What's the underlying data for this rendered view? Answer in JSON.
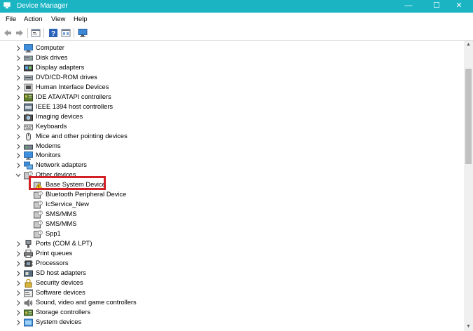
{
  "window": {
    "title": "Device Manager",
    "controls": {
      "minimize": "—",
      "maximize": "☐",
      "close": "✕"
    }
  },
  "menu": [
    "File",
    "Action",
    "View",
    "Help"
  ],
  "toolbar": [
    {
      "icon": "back-arrow-icon"
    },
    {
      "icon": "forward-arrow-icon"
    },
    {
      "icon": "properties-icon"
    },
    {
      "icon": "help-icon"
    },
    {
      "icon": "show-hidden-icon"
    },
    {
      "icon": "monitor-scan-icon"
    }
  ],
  "tree": {
    "categories": [
      {
        "label": "Computer",
        "icon": "computer-icon",
        "expanded": false
      },
      {
        "label": "Disk drives",
        "icon": "disk-drive-icon",
        "expanded": false
      },
      {
        "label": "Display adapters",
        "icon": "display-adapter-icon",
        "expanded": false
      },
      {
        "label": "DVD/CD-ROM drives",
        "icon": "dvd-drive-icon",
        "expanded": false
      },
      {
        "label": "Human Interface Devices",
        "icon": "hid-icon",
        "expanded": false
      },
      {
        "label": "IDE ATA/ATAPI controllers",
        "icon": "ide-controller-icon",
        "expanded": false
      },
      {
        "label": "IEEE 1394 host controllers",
        "icon": "ieee1394-icon",
        "expanded": false
      },
      {
        "label": "Imaging devices",
        "icon": "camera-icon",
        "expanded": false
      },
      {
        "label": "Keyboards",
        "icon": "keyboard-icon",
        "expanded": false
      },
      {
        "label": "Mice and other pointing devices",
        "icon": "mouse-icon",
        "expanded": false
      },
      {
        "label": "Modems",
        "icon": "modem-icon",
        "expanded": false
      },
      {
        "label": "Monitors",
        "icon": "monitor-icon",
        "expanded": false
      },
      {
        "label": "Network adapters",
        "icon": "network-adapter-icon",
        "expanded": false
      },
      {
        "label": "Other devices",
        "icon": "unknown-device-icon",
        "expanded": true,
        "children": [
          {
            "label": "Base System Device",
            "icon": "warning-device-icon",
            "highlighted": true
          },
          {
            "label": "Bluetooth Peripheral Device",
            "icon": "unknown-device-icon"
          },
          {
            "label": "IcService_New",
            "icon": "unknown-device-icon"
          },
          {
            "label": "SMS/MMS",
            "icon": "unknown-device-icon"
          },
          {
            "label": "SMS/MMS",
            "icon": "unknown-device-icon"
          },
          {
            "label": "Spp1",
            "icon": "unknown-device-icon"
          }
        ]
      },
      {
        "label": "Ports (COM & LPT)",
        "icon": "port-icon",
        "expanded": false
      },
      {
        "label": "Print queues",
        "icon": "printer-icon",
        "expanded": false
      },
      {
        "label": "Processors",
        "icon": "processor-icon",
        "expanded": false
      },
      {
        "label": "SD host adapters",
        "icon": "sd-adapter-icon",
        "expanded": false
      },
      {
        "label": "Security devices",
        "icon": "security-device-icon",
        "expanded": false
      },
      {
        "label": "Software devices",
        "icon": "software-device-icon",
        "expanded": false
      },
      {
        "label": "Sound, video and game controllers",
        "icon": "sound-icon",
        "expanded": false
      },
      {
        "label": "Storage controllers",
        "icon": "storage-controller-icon",
        "expanded": false
      },
      {
        "label": "System devices",
        "icon": "system-device-icon",
        "expanded": false
      }
    ]
  },
  "colors": {
    "titlebar": "#1ab4c3",
    "highlight_border": "#d32027"
  }
}
